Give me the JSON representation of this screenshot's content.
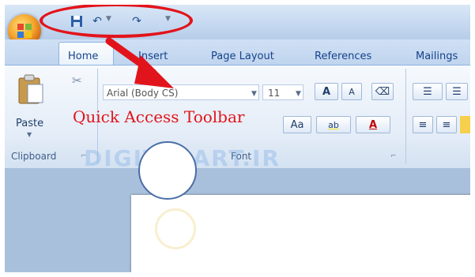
{
  "tabs": [
    "Home",
    "Insert",
    "Page Layout",
    "References",
    "Mailings"
  ],
  "clipboard": {
    "paste_label": "Paste",
    "group_label": "Clipboard"
  },
  "font": {
    "name": "Arial (Body CS)",
    "size": "11",
    "group_label": "Font",
    "change_case": "Aa",
    "grow": "A",
    "shrink": "A",
    "color": "A",
    "highlight": "ab"
  },
  "annotation": {
    "callout": "Quick Access Toolbar",
    "accent_color": "#e2141b"
  },
  "watermark": "DIGITALART.IR",
  "icons": {
    "office_button": "office-logo-icon",
    "save": "save-icon",
    "undo": "undo-icon",
    "redo": "redo-icon",
    "customize": "chevron-down-icon"
  }
}
